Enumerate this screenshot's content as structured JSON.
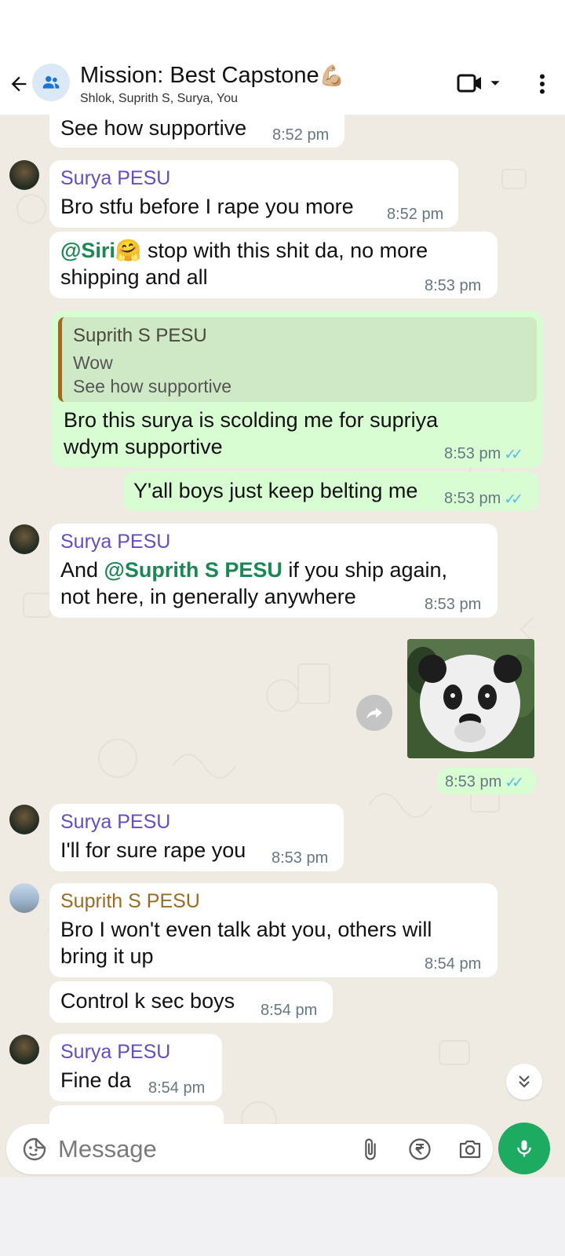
{
  "header": {
    "title": "Mission: Best Capstone",
    "title_emoji": "💪🏼",
    "subtitle": "Shlok, Suprith S, Surya, You"
  },
  "messages": [
    {
      "type": "incoming",
      "text": "See how supportive",
      "time": "8:52 pm"
    },
    {
      "type": "incoming",
      "sender": "Surya PESU",
      "text": "Bro stfu before I rape you more",
      "time": "8:52 pm"
    },
    {
      "type": "incoming",
      "mention": "@Siri",
      "mention_emoji": "🤗",
      "text_after": " stop with this shit da, no more",
      "line2": "shipping and all",
      "time": "8:53 pm"
    },
    {
      "type": "outgoing",
      "quote": {
        "sender": "Suprith S PESU",
        "line1": "Wow",
        "line2": "See how supportive"
      },
      "line1": "Bro this surya is scolding me for supriya",
      "line2": "wdym supportive",
      "time": "8:53 pm"
    },
    {
      "type": "outgoing",
      "text": "Y'all boys just keep belting me",
      "time": "8:53 pm"
    },
    {
      "type": "incoming",
      "sender": "Surya PESU",
      "prefix": "And ",
      "mention": "@Suprith S PESU",
      "suffix": " if you ship again,",
      "line2": "not here, in generally anywhere",
      "time": "8:53 pm"
    },
    {
      "type": "outgoing",
      "kind": "sticker",
      "time": "8:53 pm"
    },
    {
      "type": "incoming",
      "sender": "Surya PESU",
      "text": "I'll for sure rape you",
      "time": "8:53 pm"
    },
    {
      "type": "incoming",
      "sender": "Suprith S PESU",
      "line1": "Bro I won't even talk abt you, others will",
      "line2": "bring it up",
      "time": "8:54 pm"
    },
    {
      "type": "incoming",
      "text": "Control k sec boys",
      "time": "8:54 pm"
    },
    {
      "type": "incoming",
      "sender": "Surya PESU",
      "text": "Fine da",
      "time": "8:54 pm"
    }
  ],
  "composer": {
    "placeholder": "Message"
  },
  "colors": {
    "header_bg": "#ffffff",
    "chat_bg": "#efeae2",
    "incoming_bubble": "#ffffff",
    "outgoing_bubble": "#d9fdd3",
    "accent_green": "#1daa61",
    "read_ticks": "#53bdeb",
    "sender_surya": "#5f4fc3",
    "sender_suprith": "#9b6b23",
    "mention": "#1b8755"
  },
  "icons": [
    "back-arrow-icon",
    "group-icon",
    "video-call-icon",
    "dropdown-icon",
    "more-vert-icon",
    "forward-icon",
    "double-chevron-down-icon",
    "sticker-emoji-icon",
    "attach-icon",
    "rupee-icon",
    "camera-icon",
    "mic-icon"
  ]
}
